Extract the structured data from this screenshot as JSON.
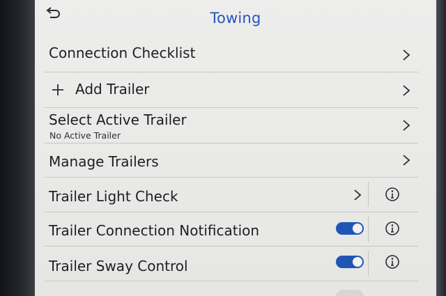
{
  "header": {
    "title": "Towing",
    "back_icon": "back-arrow-icon"
  },
  "menu": {
    "connection_checklist": {
      "label": "Connection Checklist"
    },
    "add_trailer": {
      "label": "Add Trailer"
    },
    "select_active_trailer": {
      "label": "Select Active Trailer",
      "subtitle": "No Active Trailer"
    },
    "manage_trailers": {
      "label": "Manage Trailers"
    },
    "trailer_light_check": {
      "label": "Trailer Light Check"
    },
    "trailer_connection_notification": {
      "label": "Trailer Connection Notification",
      "enabled": true
    },
    "trailer_sway_control": {
      "label": "Trailer Sway Control",
      "enabled": true
    }
  },
  "colors": {
    "accent": "#2a55b8",
    "toggle_on": "#1f56b6",
    "screen_bg": "#ececeb",
    "text": "#1e1f21"
  }
}
